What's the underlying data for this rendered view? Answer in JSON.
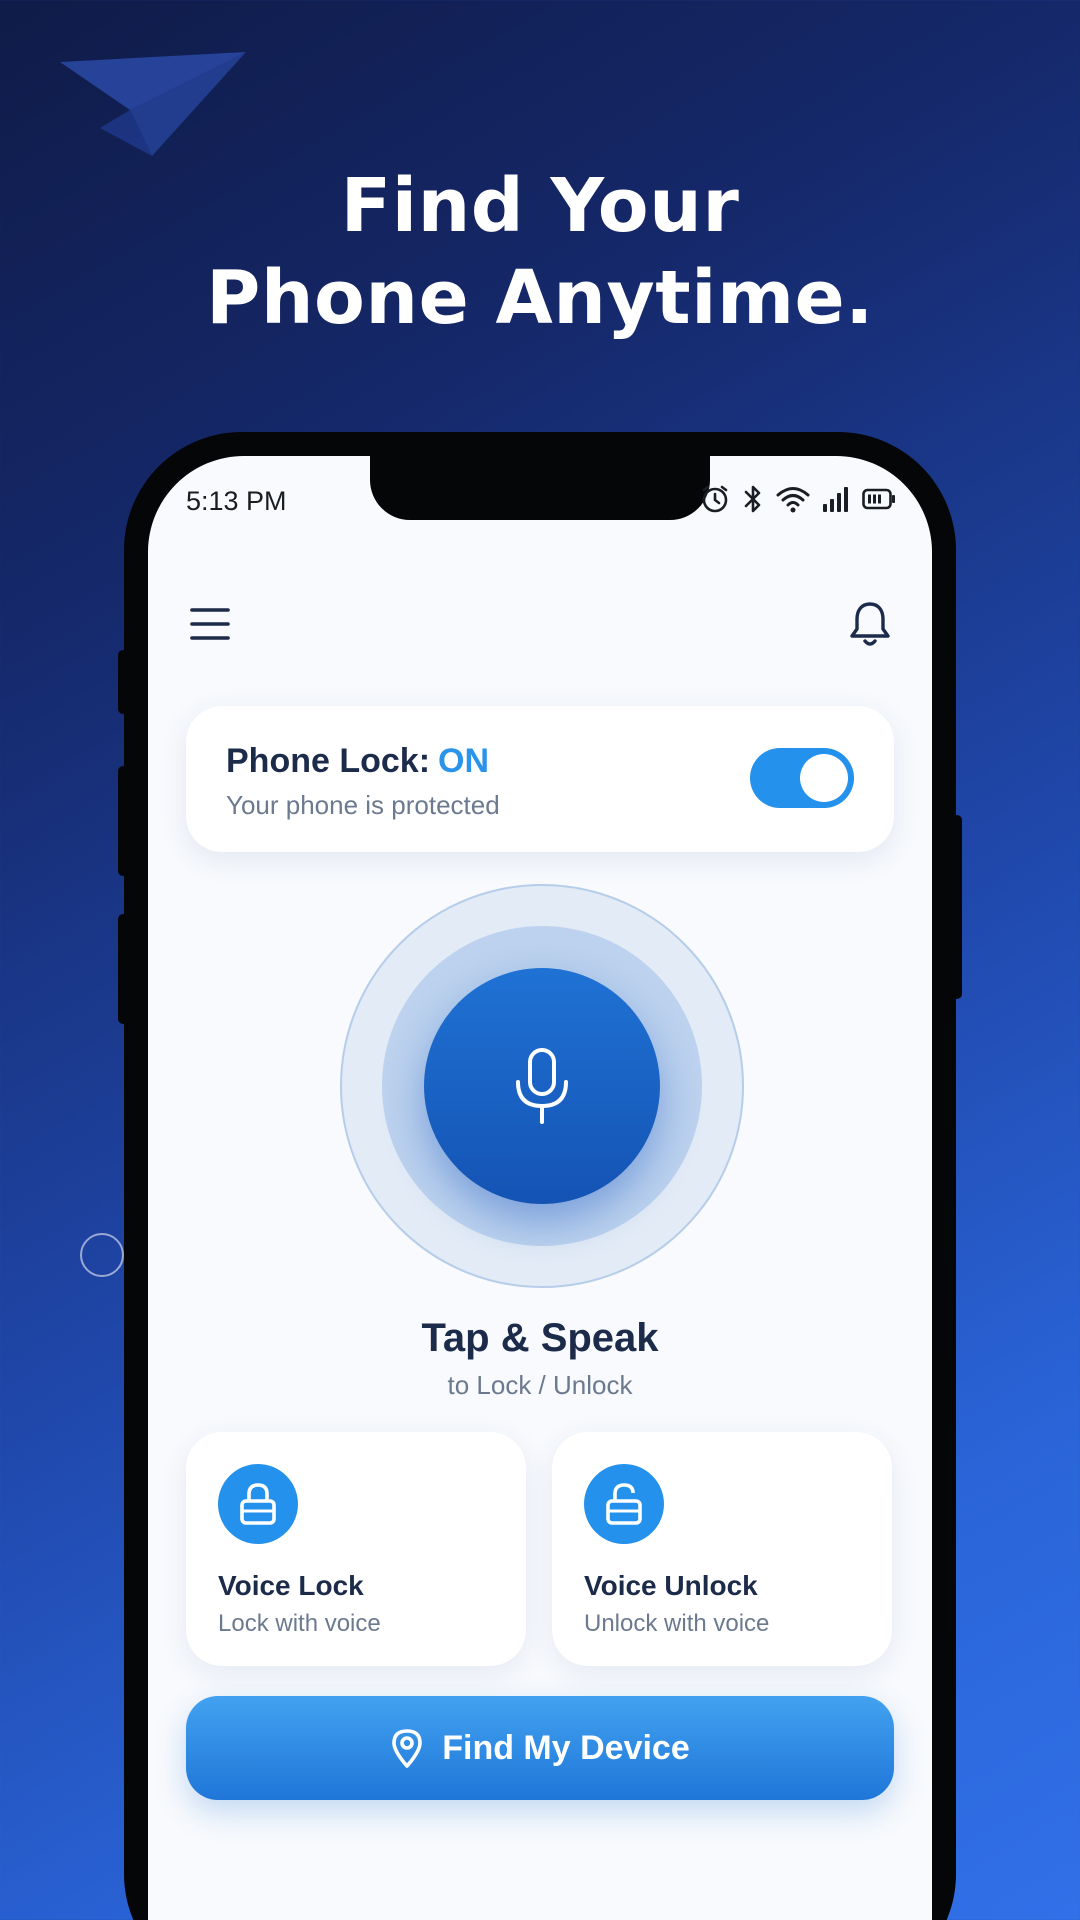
{
  "headline": {
    "line1": "Find Your",
    "line2": "Phone Anytime."
  },
  "status_bar": {
    "time": "5:13 PM",
    "icons": [
      "alarm-icon",
      "bluetooth-icon",
      "wifi-icon",
      "signal-icon",
      "battery-icon"
    ]
  },
  "header": {
    "menu_icon": "menu-icon",
    "notification_icon": "bell-icon"
  },
  "lock_card": {
    "title": "Phone Lock:",
    "state": "ON",
    "subtitle": "Your phone is protected",
    "toggle_on": true
  },
  "voice": {
    "icon": "microphone-icon",
    "title": "Tap & Speak",
    "subtitle": "to Lock / Unlock"
  },
  "actions": [
    {
      "icon": "lock-icon",
      "title": "Voice Lock",
      "subtitle": "Lock with voice"
    },
    {
      "icon": "unlock-icon",
      "title": "Voice Unlock",
      "subtitle": "Unlock with voice"
    }
  ],
  "find_button": {
    "icon": "location-pin-icon",
    "label": "Find My Device"
  },
  "colors": {
    "accent": "#2491ec",
    "title_text": "#1c2b4a",
    "muted_text": "#6c7a90",
    "background_start": "#0f1b48",
    "background_end": "#3170e8"
  }
}
